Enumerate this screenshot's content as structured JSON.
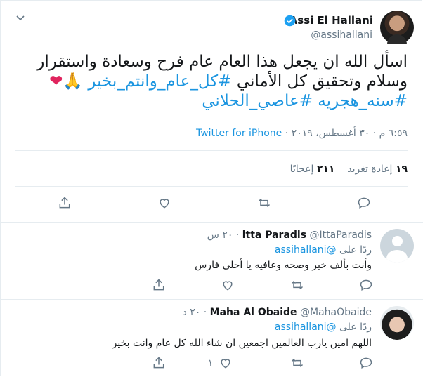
{
  "main_tweet": {
    "author_name": "Assi El Hallani",
    "author_handle": "@assihallani",
    "text_line1": "اسأل الله ان يجعل هذا العام عام فرح وسعادة واستقرار",
    "text_line2_plain": "وسلام وتحقيق كل الأماني ",
    "text_line2_hashtag": "#كل_عام_وانتم_بخير",
    "emoji_hands": "🙏",
    "emoji_heart": "❤",
    "hashtag_3": "#سنه_هجريه",
    "hashtag_4": "#عاصي_الحلاني",
    "timestamp": "٦:٥٩ م · ٣٠ أغسطس، ٢٠١٩ · ",
    "source": "Twitter for iPhone",
    "retweets_count": "١٩",
    "retweets_label": "إعادة تغريد",
    "likes_count": "٢١١",
    "likes_label": "إعجابًا"
  },
  "replies": [
    {
      "name": "itta Paradis",
      "handle": "@IttaParadis",
      "time": "٢٠ س",
      "replying_to_label": "ردًا على",
      "replying_to_handle": "@assihallani",
      "text": "وأنت بألف خير وصحه وعافيه يا أحلى فارس",
      "like_count": ""
    },
    {
      "name": "Maha Al Obaide",
      "handle": "@MahaObaide",
      "time": "٢٠ د",
      "replying_to_label": "ردًا على",
      "replying_to_handle": "@assihallani",
      "text": "اللهم امين يارب العالمين اجمعين ان شاء الله كل عام وانت بخير",
      "like_count": "١"
    }
  ],
  "colors": {
    "link": "#1b95e0",
    "secondary_text": "#657786",
    "border": "#e6ecf0",
    "heart": "#e0245e"
  },
  "icons": [
    "chevron-down-icon",
    "verified-badge-icon",
    "reply-icon",
    "retweet-icon",
    "like-icon",
    "share-icon"
  ]
}
